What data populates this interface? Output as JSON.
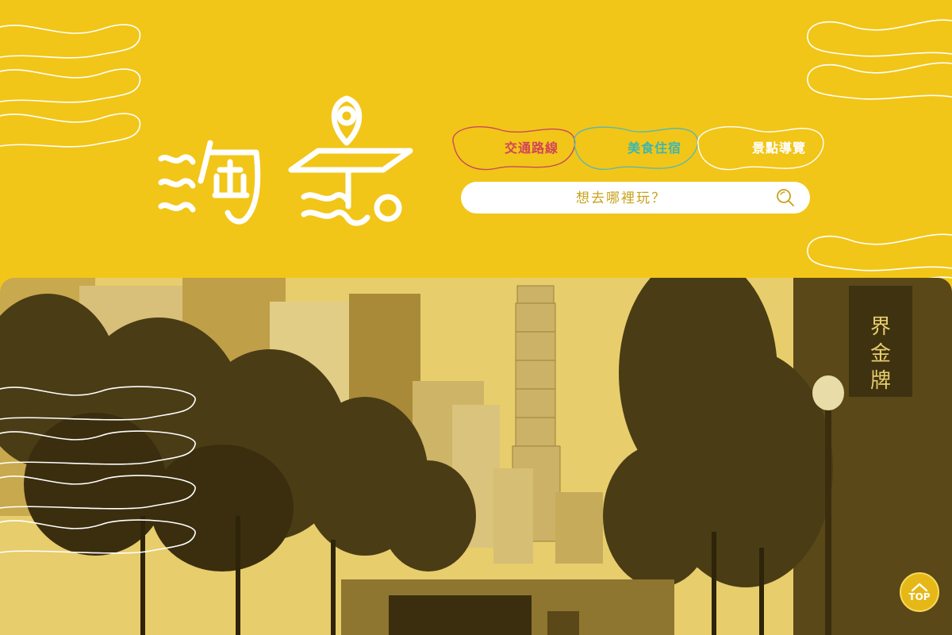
{
  "brand": {
    "logo_text": "淘景",
    "logo_alt": "map-pin-logo"
  },
  "nav": {
    "items": [
      {
        "label": "交通路線",
        "color": "#D2445A",
        "outline": "#C74A5A"
      },
      {
        "label": "美食住宿",
        "color": "#3FB6AE",
        "outline": "#5DB8B0"
      },
      {
        "label": "景點導覽",
        "color": "#FFFFFF",
        "outline": "#FFFFFF"
      }
    ]
  },
  "search": {
    "placeholder": "想去哪裡玩？",
    "icon": "search-icon"
  },
  "hero": {
    "description_icon": "city-street-photo"
  },
  "top_button": {
    "label": "TOP",
    "icon": "chevron-up-icon"
  },
  "colors": {
    "background": "#F2C618",
    "wave_lines": "#FFFFFF",
    "accent_red": "#D2445A",
    "accent_teal": "#3FB6AE"
  }
}
